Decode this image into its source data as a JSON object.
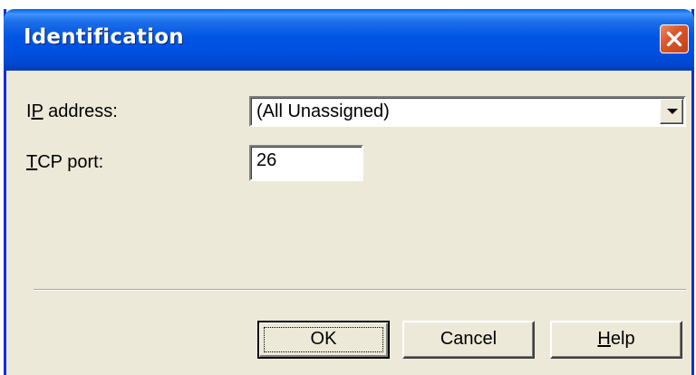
{
  "window": {
    "title": "Identification"
  },
  "form": {
    "ip_address": {
      "label_accel": "I",
      "label_accel_letter": "P",
      "label_rest": " address:",
      "value": "(All Unassigned)"
    },
    "tcp_port": {
      "label_accel_letter": "T",
      "label_rest": "CP port:",
      "value": "26"
    }
  },
  "buttons": {
    "ok_label": "OK",
    "cancel_label": "Cancel",
    "help_accel_letter": "H",
    "help_rest": "elp"
  },
  "icons": {
    "close": "close-icon",
    "dropdown": "chevron-down-icon"
  },
  "colors": {
    "titlebar": "#0055e5",
    "close_button": "#d9572b",
    "dialog_face": "#ece9d8"
  }
}
